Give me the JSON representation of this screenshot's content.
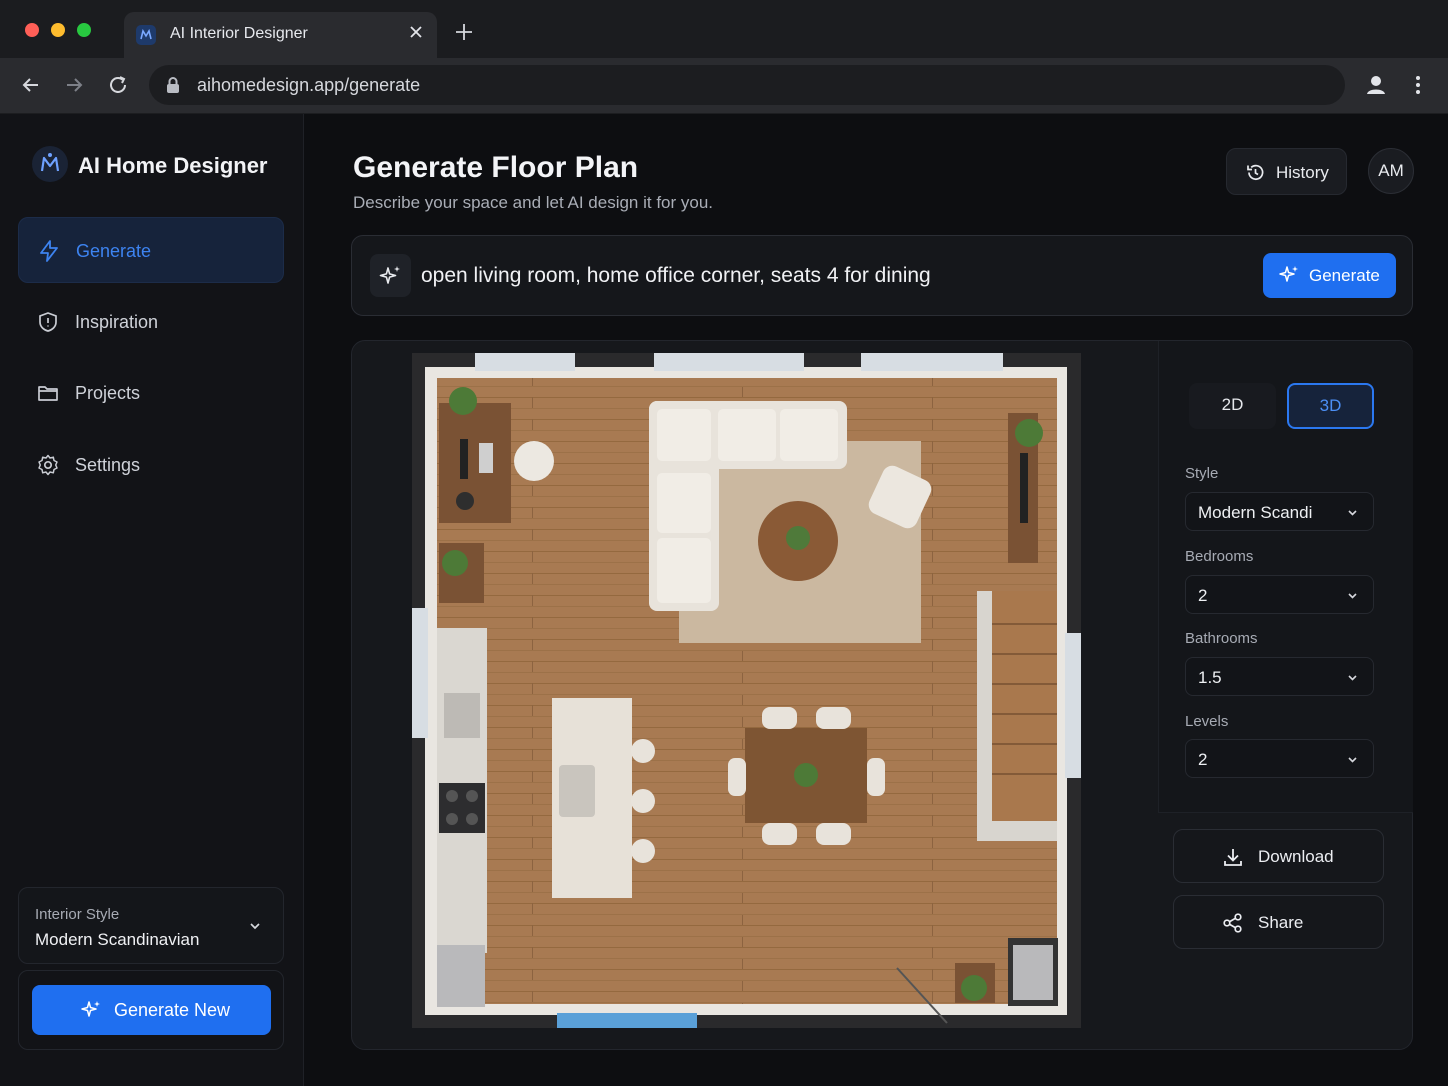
{
  "browser": {
    "tab_title": "AI Interior Designer",
    "url": "aihomedesign.app/generate"
  },
  "sidebar": {
    "brand": "AI Home Designer",
    "items": [
      {
        "label": "Generate",
        "icon": "lightning-icon",
        "active": true
      },
      {
        "label": "Inspiration",
        "icon": "lightbulb-icon",
        "active": false
      },
      {
        "label": "Projects",
        "icon": "folder-icon",
        "active": false
      },
      {
        "label": "Settings",
        "icon": "gear-icon",
        "active": false
      }
    ],
    "interior_style": {
      "label": "Interior Style",
      "value": "Modern Scandinavian"
    },
    "generate_new_label": "Generate New"
  },
  "header": {
    "title": "Generate Floor Plan",
    "subtitle": "Describe your space and let AI design it for you.",
    "history_label": "History",
    "avatar_initials": "AM"
  },
  "prompt": {
    "text": "open living room, home office corner, seats 4 for dining",
    "button_label": "Generate"
  },
  "view": {
    "toggle_2d": "2D",
    "toggle_3d": "3D",
    "active": "3D"
  },
  "options": {
    "style": {
      "label": "Style",
      "value": "Modern Scandi"
    },
    "bedrooms": {
      "label": "Bedrooms",
      "value": "2"
    },
    "bathrooms": {
      "label": "Bathrooms",
      "value": "1.5"
    },
    "levels": {
      "label": "Levels",
      "value": "2"
    }
  },
  "actions": {
    "download": "Download",
    "share": "Share"
  },
  "colors": {
    "accent": "#1f6ff0",
    "active_nav_text": "#3d83f0",
    "background": "#0d0e11",
    "floor_wood": "#a87a52"
  }
}
